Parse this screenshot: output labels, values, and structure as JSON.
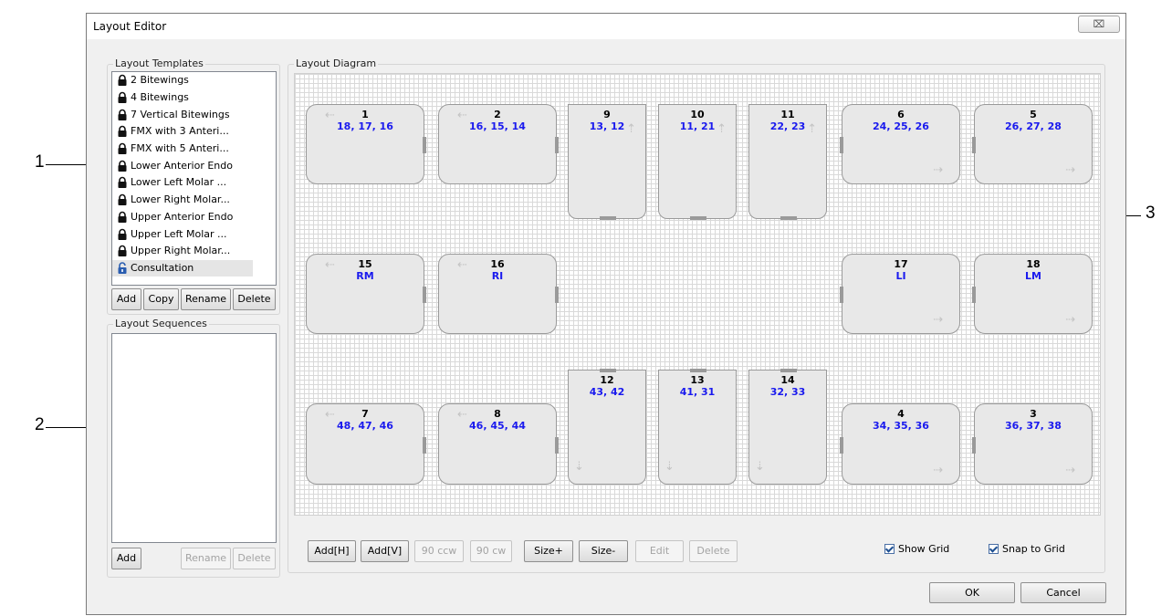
{
  "callouts": [
    "1",
    "2",
    "3"
  ],
  "window": {
    "title": "Layout Editor",
    "close_glyph": "⌧"
  },
  "templates": {
    "label": "Layout Templates",
    "items": [
      {
        "label": "2 Bitewings",
        "locked": true
      },
      {
        "label": "4 Bitewings",
        "locked": true
      },
      {
        "label": "7 Vertical Bitewings",
        "locked": true
      },
      {
        "label": "FMX with 3 Anteri...",
        "locked": true
      },
      {
        "label": "FMX with 5 Anteri...",
        "locked": true
      },
      {
        "label": "Lower Anterior Endo",
        "locked": true
      },
      {
        "label": "Lower Left Molar ...",
        "locked": true
      },
      {
        "label": "Lower Right Molar...",
        "locked": true
      },
      {
        "label": "Upper Anterior Endo",
        "locked": true
      },
      {
        "label": "Upper Left Molar ...",
        "locked": true
      },
      {
        "label": "Upper Right Molar...",
        "locked": true
      },
      {
        "label": "Consultation",
        "locked": false
      }
    ],
    "buttons": {
      "add": "Add",
      "copy": "Copy",
      "rename": "Rename",
      "delete": "Delete"
    }
  },
  "sequences": {
    "label": "Layout Sequences",
    "buttons": {
      "add": "Add",
      "rename": "Rename",
      "delete": "Delete"
    }
  },
  "diagram": {
    "label": "Layout Diagram",
    "tiles": [
      {
        "num": "1",
        "teeth": "18, 17, 16"
      },
      {
        "num": "2",
        "teeth": "16, 15, 14"
      },
      {
        "num": "9",
        "teeth": "13, 12"
      },
      {
        "num": "10",
        "teeth": "11, 21"
      },
      {
        "num": "11",
        "teeth": "22, 23"
      },
      {
        "num": "6",
        "teeth": "24, 25, 26"
      },
      {
        "num": "5",
        "teeth": "26, 27, 28"
      },
      {
        "num": "15",
        "teeth": "RM"
      },
      {
        "num": "16",
        "teeth": "RI"
      },
      {
        "num": "17",
        "teeth": "LI"
      },
      {
        "num": "18",
        "teeth": "LM"
      },
      {
        "num": "12",
        "teeth": "43, 42"
      },
      {
        "num": "13",
        "teeth": "41, 31"
      },
      {
        "num": "14",
        "teeth": "32, 33"
      },
      {
        "num": "7",
        "teeth": "48, 47, 46"
      },
      {
        "num": "8",
        "teeth": "46, 45, 44"
      },
      {
        "num": "4",
        "teeth": "34, 35, 36"
      },
      {
        "num": "3",
        "teeth": "36, 37, 38"
      }
    ],
    "toolbar": {
      "add_h": "Add[H]",
      "add_v": "Add[V]",
      "ccw": "90 ccw",
      "cw": "90 cw",
      "size_plus": "Size+",
      "size_minus": "Size-",
      "edit": "Edit",
      "delete": "Delete"
    },
    "show_grid": {
      "label": "Show Grid",
      "checked": true
    },
    "snap_grid": {
      "label": "Snap to Grid",
      "checked": true
    }
  },
  "footer": {
    "ok": "OK",
    "cancel": "Cancel"
  }
}
